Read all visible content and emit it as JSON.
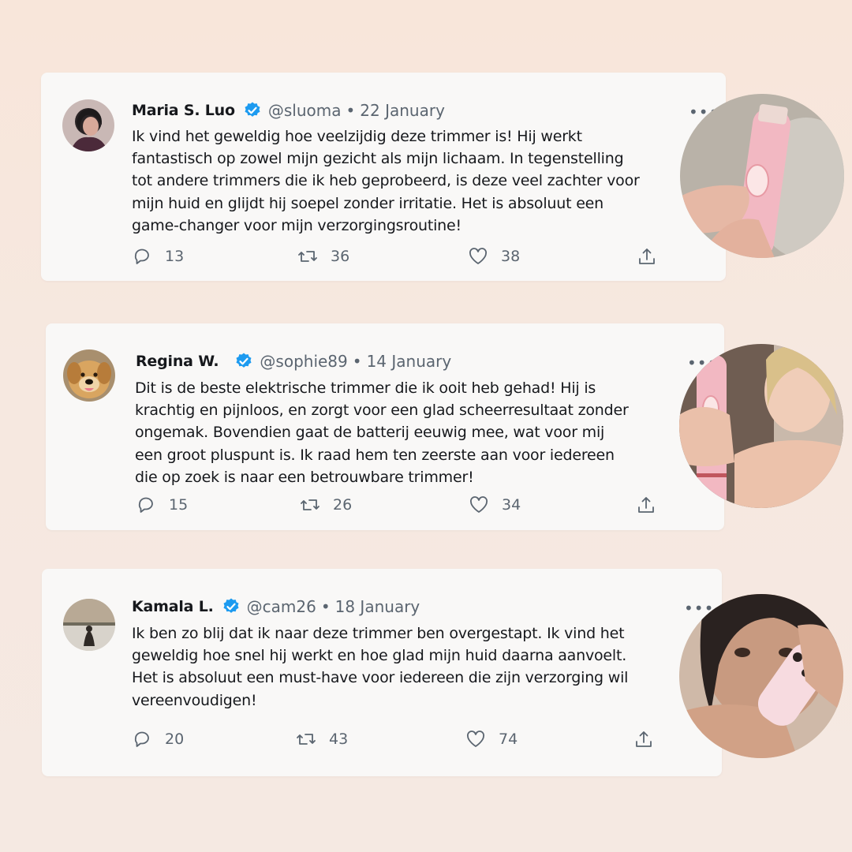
{
  "tweets": [
    {
      "name": "Maria S. Luo",
      "handle": "@sluoma",
      "date": "22 January",
      "text": "Ik vind het geweldig hoe veelzijdig deze trimmer is! Hij werkt\nfantastisch op zowel mijn gezicht als mijn lichaam. In tegenstelling\ntot andere trimmers die ik heb geprobeerd, is deze veel zachter voor\nmijn huid en glijdt hij soepel zonder irritatie. Het is absoluut een\ngame-changer voor mijn verzorgingsroutine!",
      "replies": "13",
      "retweets": "36",
      "likes": "38",
      "more": "•••"
    },
    {
      "name": "Regina W.",
      "handle": "@sophie89",
      "date": "14 January",
      "text": "Dit is de beste elektrische trimmer die ik ooit heb gehad! Hij is\nkrachtig en pijnloos, en zorgt voor een glad scheerresultaat zonder\nongemak. Bovendien gaat de batterij eeuwig mee, wat voor mij\neen groot pluspunt is. Ik raad hem ten zeerste aan voor iedereen\ndie op zoek is naar een betrouwbare trimmer!",
      "replies": "15",
      "retweets": "26",
      "likes": "34",
      "more": "•••"
    },
    {
      "name": "Kamala L.",
      "handle": "@cam26",
      "date": "18 January",
      "text": "Ik ben zo blij dat ik naar deze trimmer ben overgestapt. Ik vind het\ngeweldig hoe snel hij werkt en hoe glad mijn huid daarna aanvoelt.\nHet is absoluut een must-have voor iedereen die zijn verzorging wil\nvereenvoudigen!",
      "replies": "20",
      "retweets": "43",
      "likes": "74",
      "more": "•••"
    }
  ],
  "separator": "•",
  "colors": {
    "verified_blue": "#1d9bf0",
    "muted_text": "#5b6570",
    "card_bg": "#f9f8f7",
    "trimmer_pink": "#f2b8c2"
  },
  "icons": [
    "verified-badge-icon",
    "reply-icon",
    "retweet-icon",
    "like-icon",
    "share-icon",
    "more-options-icon"
  ]
}
